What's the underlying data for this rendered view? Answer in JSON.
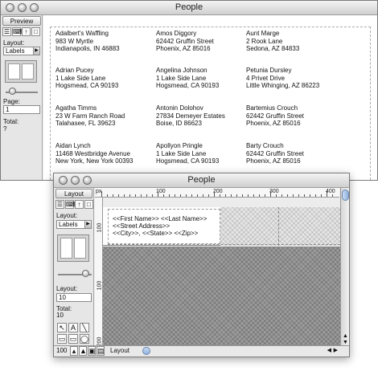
{
  "back_window": {
    "title": "People",
    "side": {
      "tab": "Preview",
      "tool_icons": [
        "☰",
        "⌨",
        "↑",
        "□"
      ],
      "layout_label": "Layout:",
      "layout_value": "Labels",
      "page_label": "Page:",
      "page_value": "1",
      "total_label": "Total:",
      "total_value": "?"
    },
    "labels": [
      [
        "Adalbert's Waffling",
        "983 W Myrtle",
        "Indianapolis, IN 46883"
      ],
      [
        "Amos Diggory",
        "62442 Gruffin Street",
        "Phoenix, AZ 85016"
      ],
      [
        "Aunt Marge",
        "2 Rook Lane",
        "Sedona, AZ 84833"
      ],
      [
        "Adrian Pucey",
        "1 Lake Side Lane",
        "Hogsmead, CA 90193"
      ],
      [
        "Angelina Johnson",
        "1 Lake Side Lane",
        "Hogsmead, CA 90193"
      ],
      [
        "Petunia Dursley",
        "4 Privet Drive",
        "Little Whinging, AZ 86223"
      ],
      [
        "Agatha Timms",
        "23 W Farm Ranch Road",
        "Talahasee, FL 39623"
      ],
      [
        "Antonin Dolohov",
        "27834 Demeyer Estates",
        "Boise, ID 86623"
      ],
      [
        "Bartemius Crouch",
        "62442 Gruffin Street",
        "Phoenix, AZ 85016"
      ],
      [
        "Aidan Lynch",
        "11468 Westbridge Avenue",
        "New York, New York 00393"
      ],
      [
        "Apollyon Pringle",
        "1 Lake Side Lane",
        "Hogsmead, CA 90193"
      ],
      [
        "Barty Crouch",
        "62442 Gruffin Street",
        "Phoenix, AZ 85016"
      ]
    ]
  },
  "front_window": {
    "title": "People",
    "side": {
      "tab": "Layout",
      "tool_icons": [
        "☰",
        "⌨",
        "↑",
        "□"
      ],
      "layout_label": "Layout:",
      "layout_value": "Labels",
      "layout_count_label": "Layout:",
      "layout_count_value": "10",
      "total_label": "Total:",
      "total_value": "10",
      "tools": [
        "↖",
        "A",
        "╲",
        "▭",
        "▭",
        "◯",
        "☑",
        "▣",
        "☰",
        "⚙",
        "▦",
        "≡"
      ]
    },
    "ruler": {
      "unit": "px",
      "h_numbers": [
        "100",
        "200",
        "300",
        "400"
      ],
      "v_numbers": [
        "100",
        "100",
        "200"
      ]
    },
    "merge_fields": [
      "<<First Name>> <<Last Name>>",
      "<<Street Address>>",
      "<<City>>, <<State>> <<Zip>>"
    ],
    "bottom": {
      "zoom": "100",
      "mode": "Layout"
    }
  }
}
